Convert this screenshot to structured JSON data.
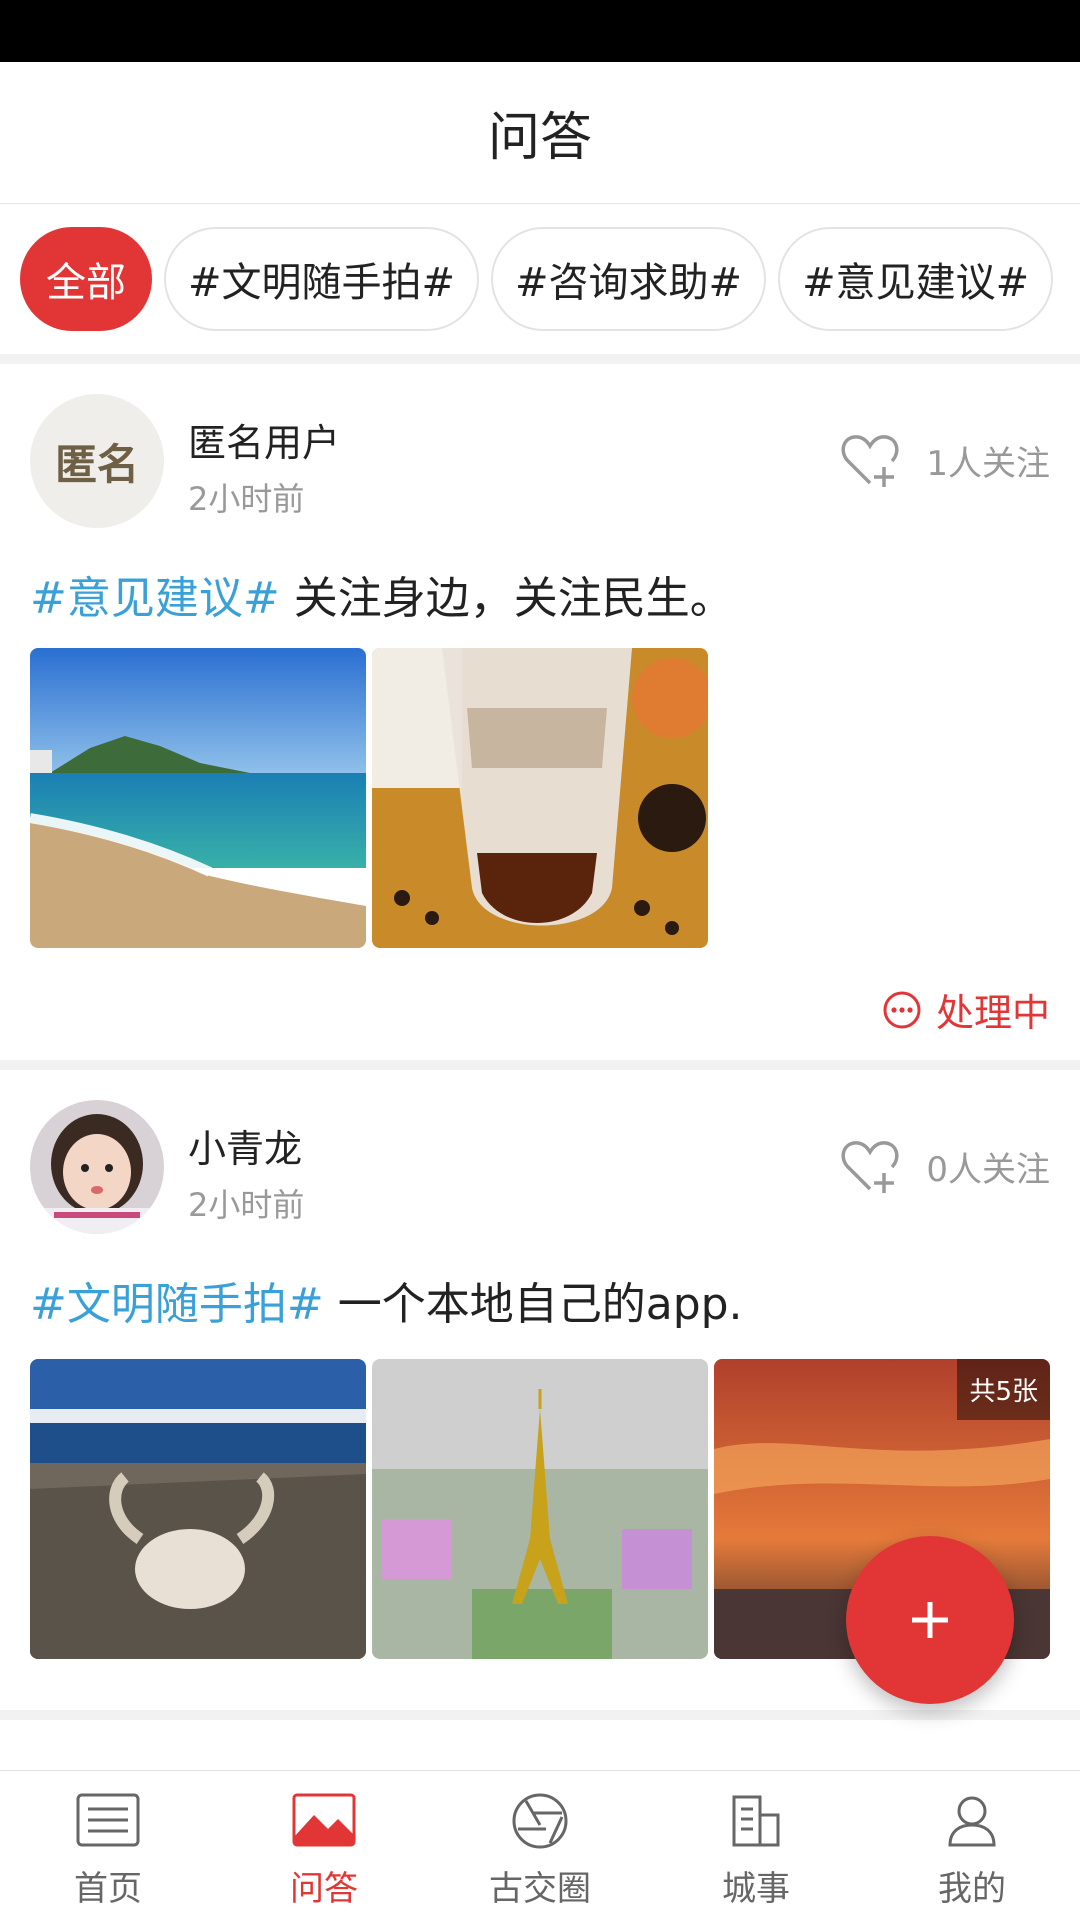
{
  "header": {
    "title": "问答"
  },
  "tags": [
    {
      "label": "全部",
      "active": true
    },
    {
      "label": "#文明随手拍#",
      "active": false
    },
    {
      "label": "#咨询求助#",
      "active": false
    },
    {
      "label": "#意见建议#",
      "active": false
    }
  ],
  "posts": [
    {
      "avatar_text": "匿名",
      "username": "匿名用户",
      "time": "2小时前",
      "follow_count": "1人关注",
      "hashtag": "#意见建议#",
      "text": "关注身边，关注民生。",
      "photos": [
        "beach-photo",
        "coffee-photo"
      ],
      "status": "处理中"
    },
    {
      "username": "小青龙",
      "time": "2小时前",
      "follow_count": "0人关注",
      "hashtag": "#文明随手拍#",
      "text": "一个本地自己的app.",
      "photos": [
        "yak-skull-photo",
        "eiffel-tower-photo",
        "sunset-photo"
      ],
      "photo_count": "共5张"
    }
  ],
  "tabbar": [
    {
      "label": "首页",
      "icon": "news-icon",
      "active": false
    },
    {
      "label": "问答",
      "icon": "image-icon",
      "active": true
    },
    {
      "label": "古交圈",
      "icon": "aperture-icon",
      "active": false
    },
    {
      "label": "城事",
      "icon": "building-icon",
      "active": false
    },
    {
      "label": "我的",
      "icon": "person-icon",
      "active": false
    }
  ],
  "colors": {
    "accent": "#e23636",
    "hashtag": "#3aa0d8"
  }
}
